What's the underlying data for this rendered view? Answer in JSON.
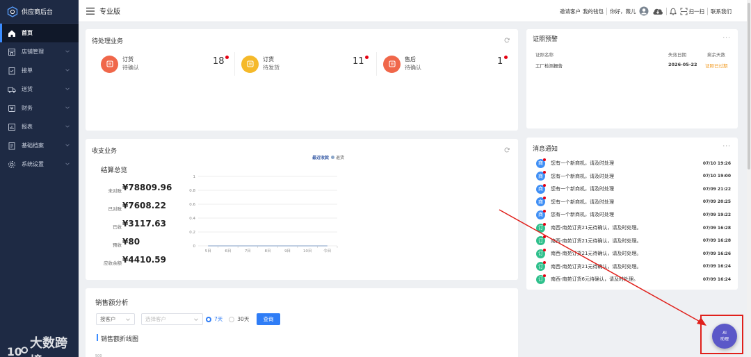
{
  "app": {
    "brand": "供应商后台"
  },
  "sidebar": {
    "items": [
      {
        "label": "首页",
        "icon": "home-icon",
        "active": true
      },
      {
        "label": "店铺管理",
        "icon": "shop-icon"
      },
      {
        "label": "接单",
        "icon": "order-icon"
      },
      {
        "label": "送货",
        "icon": "truck-icon"
      },
      {
        "label": "财务",
        "icon": "finance-icon"
      },
      {
        "label": "报表",
        "icon": "report-icon"
      },
      {
        "label": "基础档案",
        "icon": "archive-icon"
      },
      {
        "label": "系统设置",
        "icon": "gear-icon"
      }
    ]
  },
  "topbar": {
    "edition": "专业版",
    "invite": "邀请客户",
    "wallet": "我的钱包",
    "greeting": "你好，薇儿",
    "scan": "扫一扫",
    "contact": "联系我们"
  },
  "pending": {
    "title": "待处理业务",
    "items": [
      {
        "name": "订货",
        "sub": "待确认",
        "count": "18",
        "color": "#f0674a"
      },
      {
        "name": "订货",
        "sub": "待发货",
        "count": "11",
        "color": "#f5b92a"
      },
      {
        "name": "售后",
        "sub": "待确认",
        "count": "1",
        "color": "#f0674a"
      }
    ]
  },
  "cert": {
    "title": "证照预警",
    "headers": [
      "证照名称",
      "失效日期",
      "剩余天数"
    ],
    "rows": [
      {
        "name": "工厂检测报告",
        "date": "2026-05-22",
        "status": "证照已过期"
      }
    ]
  },
  "finance": {
    "title": "收支业务",
    "legend_income": "最近收款",
    "legend_refund": "退货",
    "summary_title": "结算总览",
    "stats": [
      {
        "label": "未对账",
        "value": "¥78809.96"
      },
      {
        "label": "已对账",
        "value": "¥7608.22"
      },
      {
        "label": "已收",
        "value": "¥3117.63"
      },
      {
        "label": "预收",
        "value": "¥80"
      },
      {
        "label": "应收余额",
        "value": "¥4410.59"
      }
    ]
  },
  "chart_data": {
    "type": "line",
    "categories": [
      "5日",
      "6日",
      "7日",
      "8日",
      "9日",
      "10日",
      "今日"
    ],
    "yticks": [
      "1",
      "0.8",
      "0.6",
      "0.4",
      "0.2",
      "0"
    ],
    "ylim": [
      0,
      1
    ],
    "series": [
      {
        "name": "最近收款",
        "values": [
          0,
          0,
          0,
          0,
          0,
          0,
          0
        ]
      },
      {
        "name": "退货",
        "values": [
          0,
          0,
          0,
          0,
          0,
          0,
          0
        ]
      }
    ]
  },
  "messages": {
    "title": "消息通知",
    "items": [
      {
        "badge": "商",
        "color": "#3f8ff5",
        "text": "您有一个新商机，请及时处理",
        "time": "07/10 19:26"
      },
      {
        "badge": "商",
        "color": "#3f8ff5",
        "text": "您有一个新商机，请及时处理",
        "time": "07/10 19:00"
      },
      {
        "badge": "商",
        "color": "#3f8ff5",
        "text": "您有一个新商机，请及时处理",
        "time": "07/09 21:22"
      },
      {
        "badge": "商",
        "color": "#3f8ff5",
        "text": "您有一个新商机，请及时处理",
        "time": "07/09 20:25"
      },
      {
        "badge": "商",
        "color": "#3f8ff5",
        "text": "您有一个新商机，请及时处理",
        "time": "07/09 19:22"
      },
      {
        "badge": "订",
        "color": "#2fc08c",
        "text": "南西-南苑订货21元待确认，请及时处理。",
        "time": "07/09 16:28"
      },
      {
        "badge": "订",
        "color": "#2fc08c",
        "text": "南西-南苑订货21元待确认，请及时处理。",
        "time": "07/09 16:28"
      },
      {
        "badge": "订",
        "color": "#2fc08c",
        "text": "南西-南苑订货21元待确认，请及时处理。",
        "time": "07/09 16:26"
      },
      {
        "badge": "订",
        "color": "#2fc08c",
        "text": "南西-南苑订货21元待确认，请及时处理。",
        "time": "07/09 16:24"
      },
      {
        "badge": "订",
        "color": "#2fc08c",
        "text": "南西-南苑订货6元待确认，请及时处理。",
        "time": "07/09 16:24"
      }
    ]
  },
  "sales": {
    "title": "销售额分析",
    "filter_value": "按客户",
    "customer_placeholder": "选择客户",
    "opt7": "7天",
    "opt30": "30天",
    "query": "查询",
    "chart_title": "销售额折线图",
    "y_top": "500"
  },
  "ai": {
    "line1": "AI",
    "line2": "助理"
  },
  "watermark": "大数跨境"
}
